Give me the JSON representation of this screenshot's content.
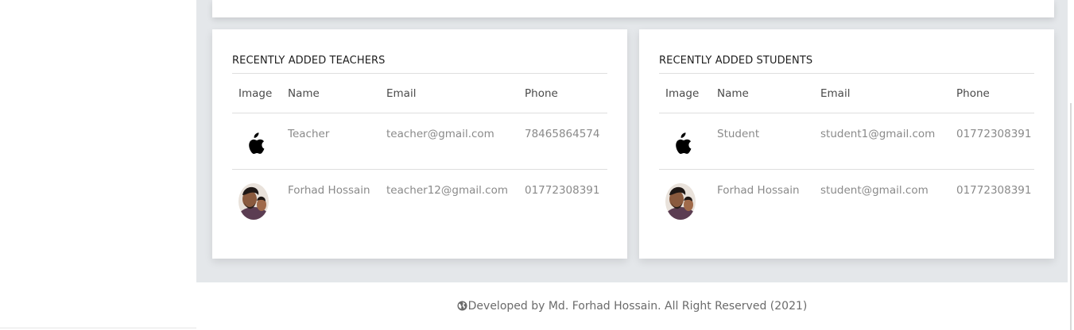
{
  "teachers_card": {
    "title": "RECENTLY ADDED TEACHERS",
    "columns": [
      "Image",
      "Name",
      "Email",
      "Phone"
    ],
    "rows": [
      {
        "image": "apple-logo-icon",
        "name": "Teacher",
        "email": "teacher@gmail.com",
        "phone": "78465864574"
      },
      {
        "image": "user-photo",
        "name": "Forhad Hossain",
        "email": "teacher12@gmail.com",
        "phone": "01772308391"
      }
    ]
  },
  "students_card": {
    "title": "RECENTLY ADDED STUDENTS",
    "columns": [
      "Image",
      "Name",
      "Email",
      "Phone"
    ],
    "rows": [
      {
        "image": "apple-logo-icon",
        "name": "Student",
        "email": "student1@gmail.com",
        "phone": "01772308391"
      },
      {
        "image": "user-photo",
        "name": "Forhad Hossain",
        "email": "student@gmail.com",
        "phone": "01772308391"
      }
    ]
  },
  "footer": {
    "icon": "globe-icon",
    "text": "Developed by Md. Forhad Hossain. All Right Reserved (2021)"
  },
  "colors": {
    "background": "#e4e7ea",
    "card": "#ffffff",
    "title_text": "#1e1e1e",
    "header_text": "#4a4a4a",
    "cell_text": "#8a8a8a"
  }
}
